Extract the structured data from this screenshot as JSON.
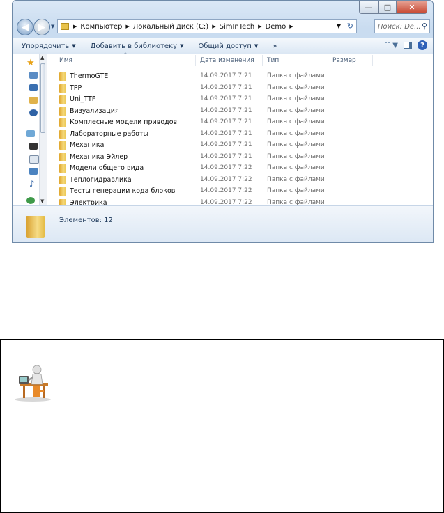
{
  "window": {
    "caption_buttons": {
      "minimize": "—",
      "maximize": "□",
      "close": "✕"
    }
  },
  "address": {
    "crumbs": [
      "Компьютер",
      "Локальный диск (C:)",
      "SimInTech",
      "Demo"
    ],
    "search_placeholder": "Поиск: De..."
  },
  "commands": {
    "organize": "Упорядочить",
    "add_library": "Добавить в библиотеку",
    "share": "Общий доступ",
    "more": "»"
  },
  "columns": {
    "name": "Имя",
    "date": "Дата изменения",
    "type": "Тип",
    "size": "Размер"
  },
  "files": [
    {
      "name": "ThermoGTE",
      "date": "14.09.2017 7:21",
      "type": "Папка с файлами"
    },
    {
      "name": "TPP",
      "date": "14.09.2017 7:21",
      "type": "Папка с файлами"
    },
    {
      "name": "Uni_TTF",
      "date": "14.09.2017 7:21",
      "type": "Папка с файлами"
    },
    {
      "name": "Визуализация",
      "date": "14.09.2017 7:21",
      "type": "Папка с файлами"
    },
    {
      "name": "Комплесные модели приводов",
      "date": "14.09.2017 7:21",
      "type": "Папка с файлами"
    },
    {
      "name": "Лабораторные работы",
      "date": "14.09.2017 7:21",
      "type": "Папка с файлами"
    },
    {
      "name": "Механика",
      "date": "14.09.2017 7:21",
      "type": "Папка с файлами"
    },
    {
      "name": "Механика Эйлер",
      "date": "14.09.2017 7:21",
      "type": "Папка с файлами"
    },
    {
      "name": "Модели общего вида",
      "date": "14.09.2017 7:22",
      "type": "Папка с файлами"
    },
    {
      "name": "Теплогидравлика",
      "date": "14.09.2017 7:22",
      "type": "Папка с файлами"
    },
    {
      "name": "Тесты генерации кода блоков",
      "date": "14.09.2017 7:22",
      "type": "Папка с файлами"
    },
    {
      "name": "Электрика",
      "date": "14.09.2017 7:22",
      "type": "Папка с файлами"
    }
  ],
  "details": {
    "count": "Элементов: 12"
  },
  "colors": {
    "folder": "#e8c24a",
    "accent": "#1e395b"
  }
}
